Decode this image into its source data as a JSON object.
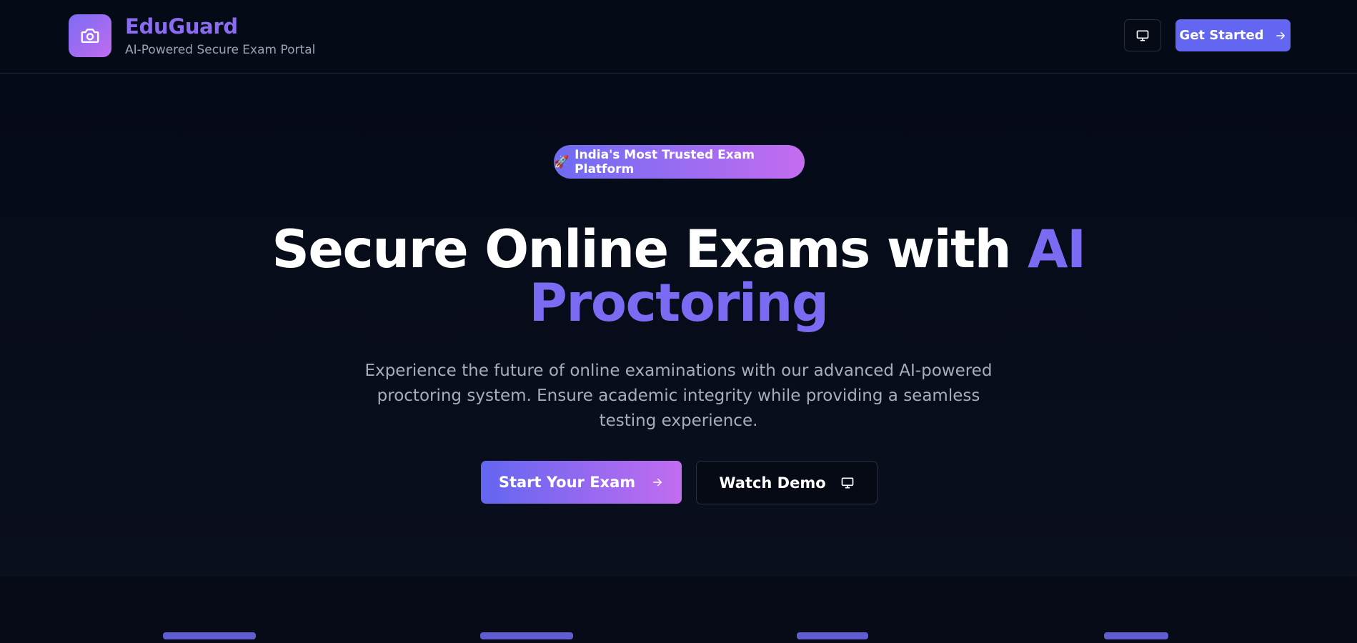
{
  "header": {
    "brand_name": "EduGuard",
    "brand_tagline": "AI-Powered Secure Exam Portal",
    "logo_icon": "camera-icon",
    "display_icon": "monitor-icon",
    "cta_label": "Get Started",
    "cta_icon": "arrow-right-icon"
  },
  "hero": {
    "badge_emoji": "🚀",
    "badge_text": "India's Most Trusted Exam Platform",
    "headline_plain": "Secure Online Exams with ",
    "headline_accent": "AI Proctoring",
    "subtext": "Experience the future of online examinations with our advanced AI-powered proctoring system. Ensure academic integrity while providing a seamless testing experience.",
    "primary_button": "Start Your Exam",
    "primary_icon": "arrow-right-icon",
    "secondary_button": "Watch Demo",
    "secondary_icon": "monitor-icon"
  },
  "colors": {
    "background": "#070b17",
    "accent": "#6366f1",
    "accent_end": "#c26cf0",
    "brand_text": "#8b6cf0",
    "muted_text": "#a5adbe"
  }
}
